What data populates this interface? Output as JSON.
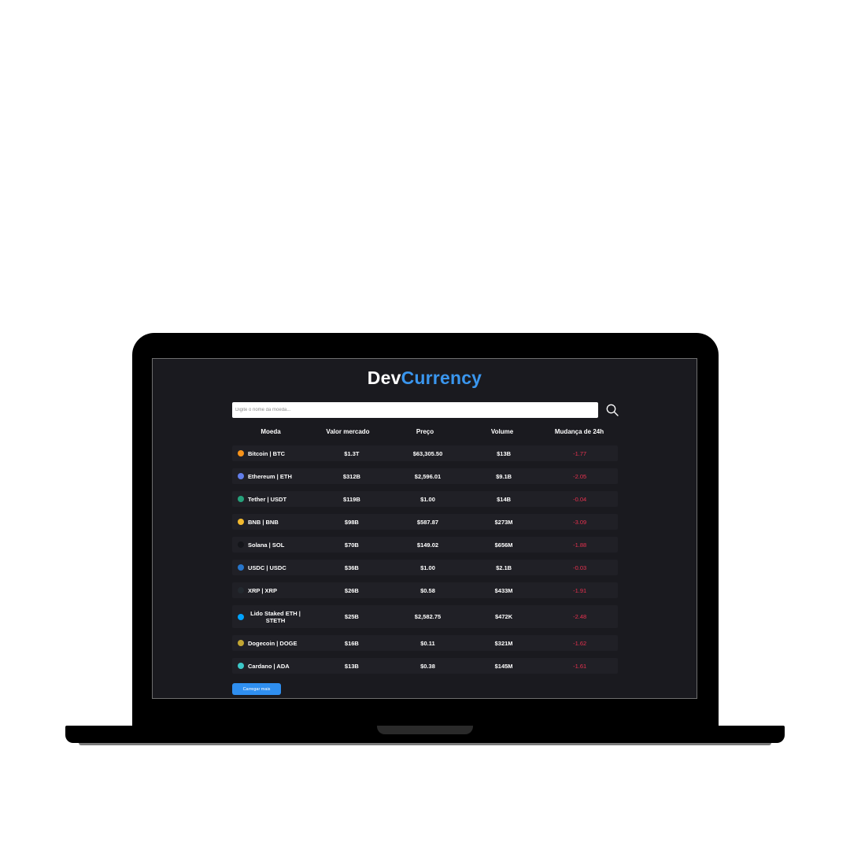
{
  "brand": {
    "part1": "Dev",
    "part2": "Currency",
    "color1": "#ffffff",
    "color2": "#3a96ee"
  },
  "search": {
    "placeholder": "Digite o nome da moeda...",
    "value": "",
    "icon": "search-icon"
  },
  "table": {
    "headers": [
      "Moeda",
      "Valor mercado",
      "Preço",
      "Volume",
      "Mudança de 24h"
    ],
    "rows": [
      {
        "coin": "Bitcoin | BTC",
        "icon_color": "#f7931a",
        "market_cap": "$1.3T",
        "price": "$63,305.50",
        "volume": "$13B",
        "change": "-1.77"
      },
      {
        "coin": "Ethereum | ETH",
        "icon_color": "#627eea",
        "market_cap": "$312B",
        "price": "$2,596.01",
        "volume": "$9.1B",
        "change": "-2.05"
      },
      {
        "coin": "Tether | USDT",
        "icon_color": "#26a17b",
        "market_cap": "$119B",
        "price": "$1.00",
        "volume": "$14B",
        "change": "-0.04"
      },
      {
        "coin": "BNB | BNB",
        "icon_color": "#f3ba2f",
        "market_cap": "$98B",
        "price": "$587.87",
        "volume": "$273M",
        "change": "-3.09"
      },
      {
        "coin": "Solana | SOL",
        "icon_color": "#14151a",
        "market_cap": "$70B",
        "price": "$149.02",
        "volume": "$656M",
        "change": "-1.88"
      },
      {
        "coin": "USDC | USDC",
        "icon_color": "#2775ca",
        "market_cap": "$36B",
        "price": "$1.00",
        "volume": "$2.1B",
        "change": "-0.03"
      },
      {
        "coin": "XRP | XRP",
        "icon_color": "#23292f",
        "market_cap": "$26B",
        "price": "$0.58",
        "volume": "$433M",
        "change": "-1.91"
      },
      {
        "coin": "Lido Staked ETH | STETH",
        "icon_color": "#00a3ff",
        "market_cap": "$25B",
        "price": "$2,582.75",
        "volume": "$472K",
        "change": "-2.48"
      },
      {
        "coin": "Dogecoin | DOGE",
        "icon_color": "#c2a633",
        "market_cap": "$16B",
        "price": "$0.11",
        "volume": "$321M",
        "change": "-1.62"
      },
      {
        "coin": "Cardano | ADA",
        "icon_color": "#3cc8c8",
        "market_cap": "$13B",
        "price": "$0.38",
        "volume": "$145M",
        "change": "-1.61"
      }
    ]
  },
  "load_more": {
    "label": "Carregar mais",
    "color": "#2f8ff0"
  },
  "colors": {
    "negative": "#e8314f",
    "screen_bg": "#1a1a1f",
    "row_bg": "#202026"
  }
}
